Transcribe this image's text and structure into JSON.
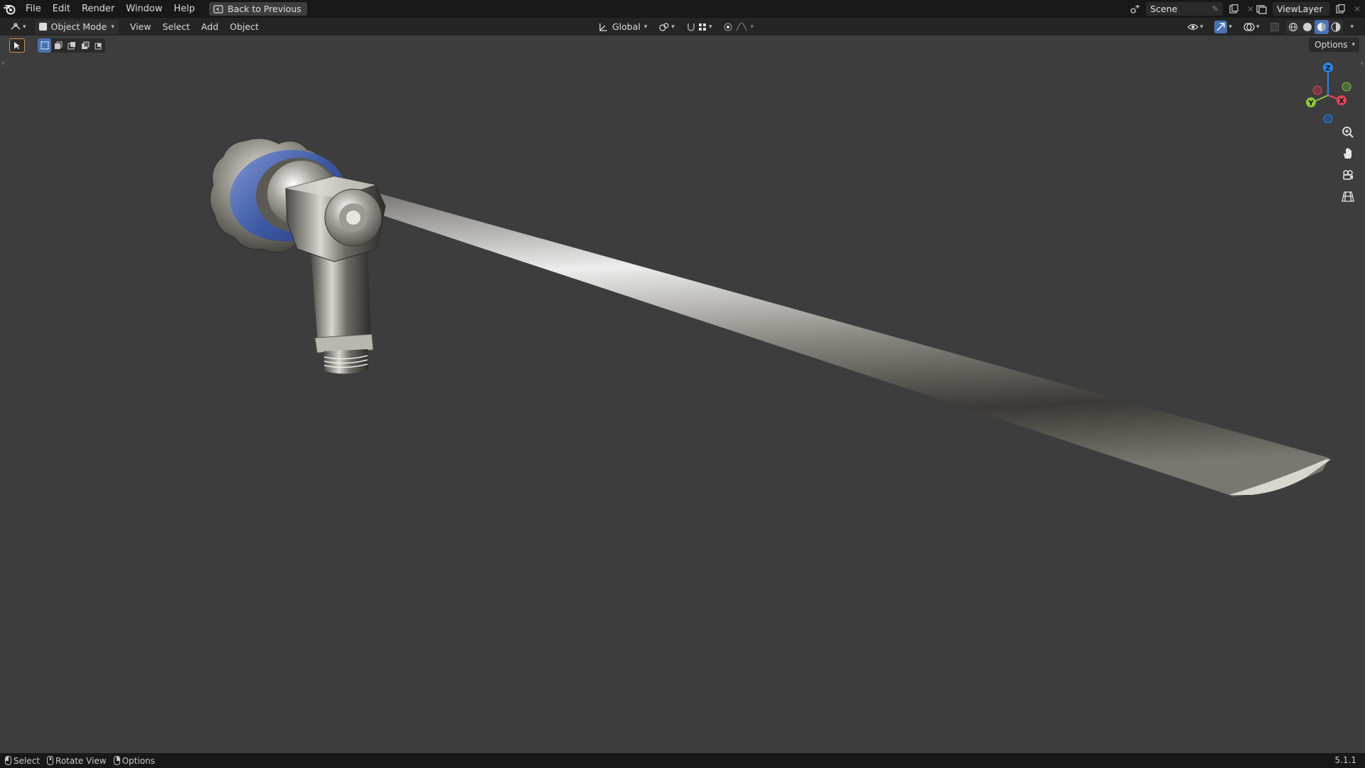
{
  "menubar": {
    "items": [
      "File",
      "Edit",
      "Render",
      "Window",
      "Help"
    ],
    "back_button": "Back to Previous",
    "scene": "Scene",
    "view_layer": "ViewLayer"
  },
  "header": {
    "mode": "Object Mode",
    "menus": [
      "View",
      "Select",
      "Add",
      "Object"
    ],
    "transform_orientation": "Global"
  },
  "viewport": {
    "options_label": "Options",
    "gizmo_axes": [
      "Z",
      "X",
      "Y"
    ]
  },
  "statusbar": {
    "items": [
      "Select",
      "Rotate View",
      "Options"
    ],
    "version": "5.1.1"
  },
  "colors": {
    "accent": "#4772b3",
    "axis_x": "#e8425b",
    "axis_y": "#8cc63f",
    "axis_z": "#2a86e8"
  }
}
